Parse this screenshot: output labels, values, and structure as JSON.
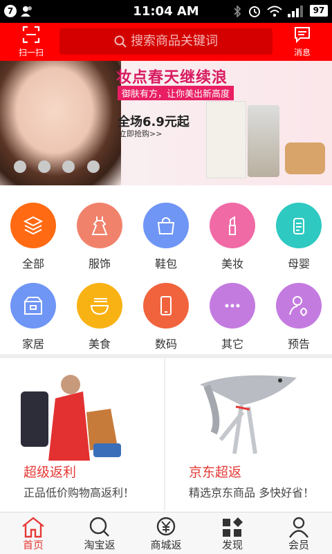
{
  "status_bar": {
    "notification_count": "7",
    "time": "11:04 AM",
    "battery": "97"
  },
  "header": {
    "scan_label": "扫一扫",
    "search_placeholder": "搜索商品关键词",
    "message_label": "消息"
  },
  "banner": {
    "title": "妆点春天继续浪",
    "slogan": "御肤有方，让你美出新高度",
    "price": "全场6.9元起",
    "cta": "立即抢购>>",
    "slides": 4
  },
  "categories": [
    {
      "label": "全部",
      "icon": "layers-icon",
      "color": "#ff6a13"
    },
    {
      "label": "服饰",
      "icon": "dress-icon",
      "color": "#f0826c"
    },
    {
      "label": "鞋包",
      "icon": "handbag-icon",
      "color": "#6f95f5"
    },
    {
      "label": "美妆",
      "icon": "lipstick-icon",
      "color": "#f06aa6"
    },
    {
      "label": "母婴",
      "icon": "baby-bottle-icon",
      "color": "#2ec9c1"
    },
    {
      "label": "家居",
      "icon": "box-icon",
      "color": "#6f95f5"
    },
    {
      "label": "美食",
      "icon": "noodle-bowl-icon",
      "color": "#f9b214"
    },
    {
      "label": "数码",
      "icon": "phone-icon",
      "color": "#f0633d"
    },
    {
      "label": "其它",
      "icon": "more-dots-icon",
      "color": "#c47be0"
    },
    {
      "label": "预告",
      "icon": "user-heart-icon",
      "color": "#c47be0"
    }
  ],
  "promos": [
    {
      "title": "超级返利",
      "subtitle": "正品低价购物高返利！"
    },
    {
      "title": "京东超返",
      "subtitle": "精选京东商品 多快好省！"
    }
  ],
  "tabs": [
    {
      "label": "首页",
      "icon": "home-icon",
      "active": true
    },
    {
      "label": "淘宝返",
      "icon": "search-icon",
      "active": false
    },
    {
      "label": "商城返",
      "icon": "yen-coin-icon",
      "active": false
    },
    {
      "label": "发现",
      "icon": "discover-grid-icon",
      "active": false
    },
    {
      "label": "会员",
      "icon": "user-icon",
      "active": false
    }
  ],
  "colors": {
    "brand_red": "#ff0000",
    "search_bg": "#d40000",
    "promo_title": "#e53935",
    "tab_active": "#e53935"
  }
}
